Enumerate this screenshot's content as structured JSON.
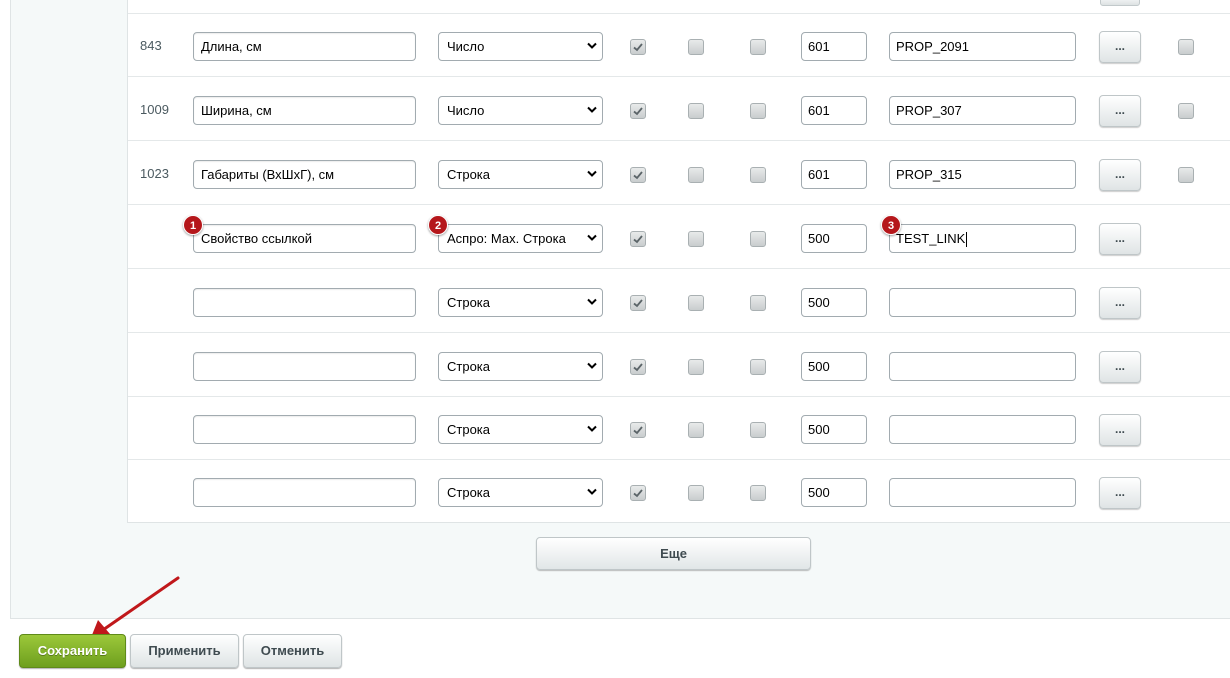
{
  "rows": [
    {
      "id": "843",
      "name": "Длина, см",
      "type": "Число",
      "sort": "601",
      "code": "PROP_2091",
      "more": "...",
      "has_delete": true
    },
    {
      "id": "1009",
      "name": "Ширина, см",
      "type": "Число",
      "sort": "601",
      "code": "PROP_307",
      "more": "...",
      "has_delete": true
    },
    {
      "id": "1023",
      "name": "Габариты (ВхШхГ), см",
      "type": "Строка",
      "sort": "601",
      "code": "PROP_315",
      "more": "...",
      "has_delete": true
    },
    {
      "id": "",
      "name": "Свойство ссылкой",
      "type": "Аспро: Мах. Строка",
      "sort": "500",
      "code": "TEST_LINK",
      "more": "...",
      "has_delete": false
    },
    {
      "id": "",
      "name": "",
      "type": "Строка",
      "sort": "500",
      "code": "",
      "more": "...",
      "has_delete": false
    },
    {
      "id": "",
      "name": "",
      "type": "Строка",
      "sort": "500",
      "code": "",
      "more": "...",
      "has_delete": false
    },
    {
      "id": "",
      "name": "",
      "type": "Строка",
      "sort": "500",
      "code": "",
      "more": "...",
      "has_delete": false
    },
    {
      "id": "",
      "name": "",
      "type": "Строка",
      "sort": "500",
      "code": "",
      "more": "...",
      "has_delete": false
    }
  ],
  "badges": [
    "1",
    "2",
    "3"
  ],
  "more_button": "Еще",
  "buttons": {
    "save": "Сохранить",
    "apply": "Применить",
    "cancel": "Отменить"
  },
  "colors": {
    "save": "#7fb02b",
    "badge": "#b5171b",
    "arrow": "#c0181b"
  }
}
